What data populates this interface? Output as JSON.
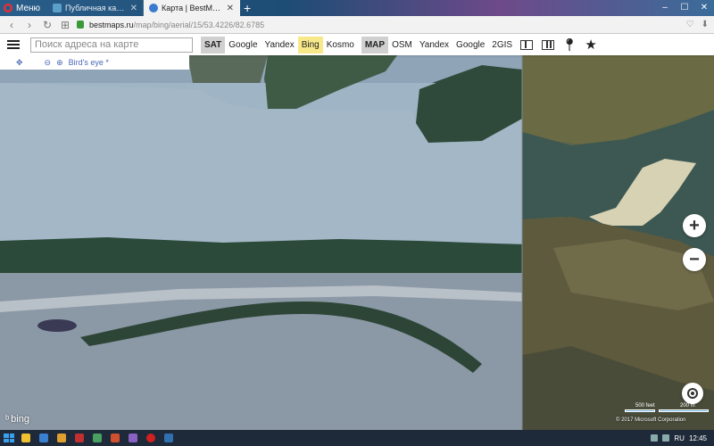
{
  "browser": {
    "menu_label": "Меню",
    "tabs": [
      {
        "title": "Публичная кадастровая",
        "fav_color": "#5aa0c8",
        "active": false
      },
      {
        "title": "Карта | BestMaps - спут",
        "fav_color": "#3a7ad0",
        "active": true
      }
    ],
    "new_tab": "+",
    "url_host": "bestmaps.ru",
    "url_path": "/map/bing/aerial/15/53.4226/82.6785"
  },
  "toolbar": {
    "search_placeholder": "Поиск адреса на карте",
    "sat_label": "SAT",
    "sat_items": [
      "Google",
      "Yandex",
      "Bing",
      "Kosmo"
    ],
    "sat_selected": "Bing",
    "map_label": "MAP",
    "map_items": [
      "OSM",
      "Yandex",
      "Google",
      "2GIS"
    ],
    "birds_eye": "Bird's eye *"
  },
  "controls": {
    "zoom_in": "+",
    "zoom_out": "−"
  },
  "attribution": {
    "bing": "bing",
    "copyright": "© 2017 Microsoft Corporation",
    "scale_left": "500 feet",
    "scale_right": "200 m"
  },
  "taskbar": {
    "lang": "RU",
    "time": "12:45"
  },
  "colors": {
    "accent_selected": "#f7e98a",
    "river_left": "#9db3c3",
    "river_right": "#3f5b55"
  }
}
